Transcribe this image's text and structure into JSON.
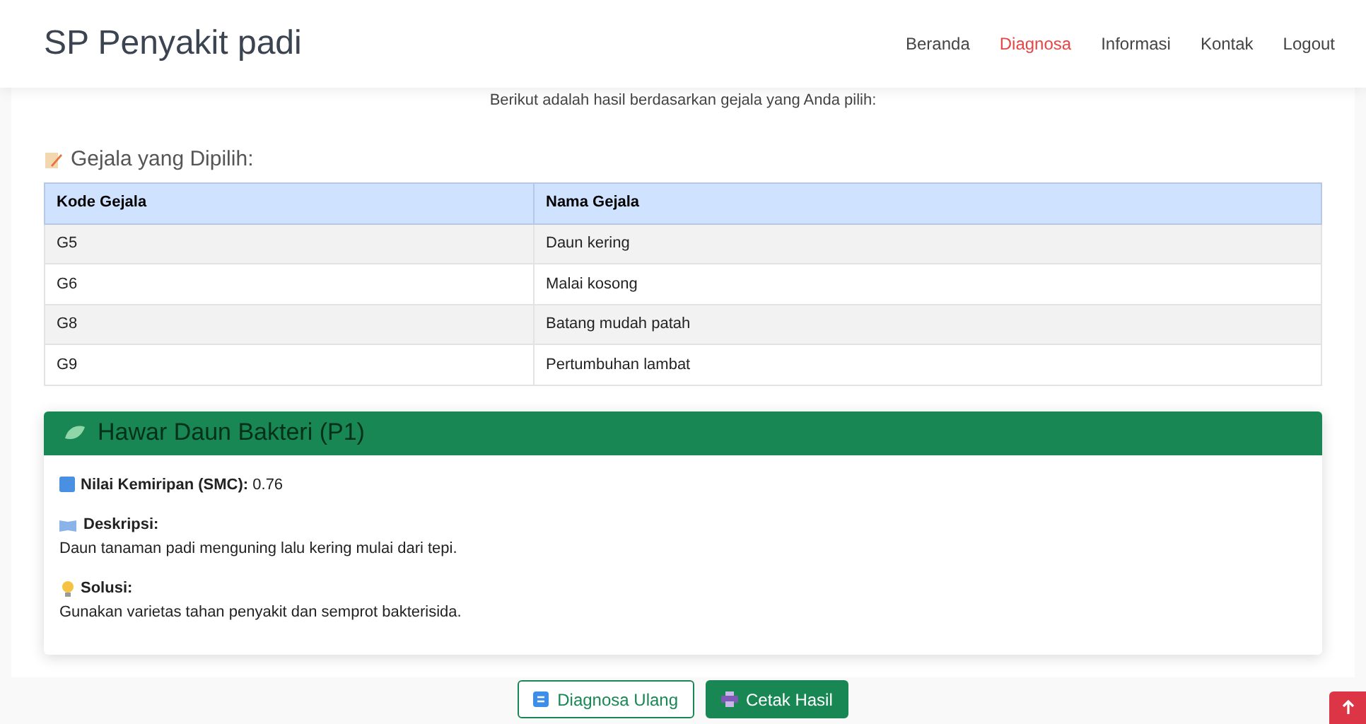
{
  "header": {
    "brand": "SP Penyakit padi",
    "nav": [
      {
        "label": "Beranda",
        "selected": false
      },
      {
        "label": "Diagnosa",
        "selected": true
      },
      {
        "label": "Informasi",
        "selected": false
      },
      {
        "label": "Kontak",
        "selected": false
      },
      {
        "label": "Logout",
        "selected": false
      }
    ]
  },
  "intro": "Berikut adalah hasil berdasarkan gejala yang Anda pilih:",
  "symptoms": {
    "title": "Gejala yang Dipilih:",
    "columns": [
      "Kode Gejala",
      "Nama Gejala"
    ],
    "rows": [
      [
        "G5",
        "Daun kering"
      ],
      [
        "G6",
        "Malai kosong"
      ],
      [
        "G8",
        "Batang mudah patah"
      ],
      [
        "G9",
        "Pertumbuhan lambat"
      ]
    ]
  },
  "result": {
    "title": "Hawar Daun Bakteri (P1)",
    "score_label": "Nilai Kemiripan (SMC):",
    "score": "0.76",
    "description_label": "Deskripsi:",
    "description": "Daun tanaman padi menguning lalu kering mulai dari tepi.",
    "solution_label": "Solusi:",
    "solution": "Gunakan varietas tahan penyakit dan semprot bakterisida."
  },
  "buttons": [
    {
      "label": "Diagnosa Ulang",
      "kind": "outline"
    },
    {
      "label": "Cetak Hasil",
      "kind": "solid"
    }
  ]
}
